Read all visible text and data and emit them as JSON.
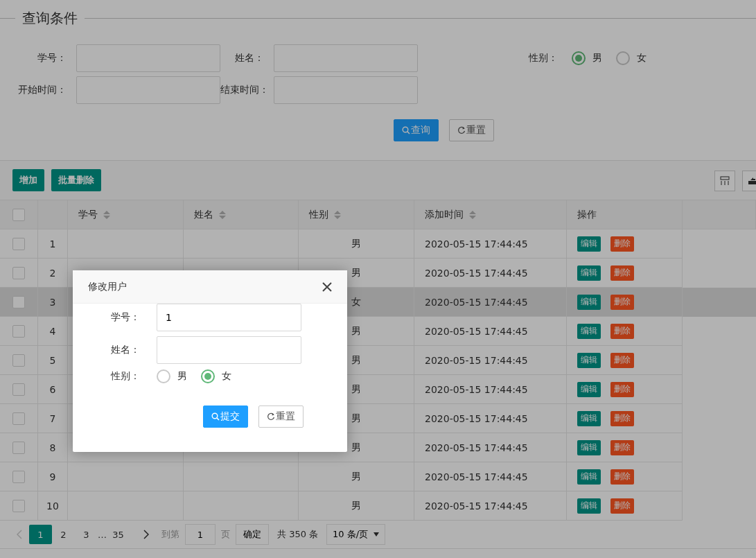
{
  "query": {
    "legend": "查询条件",
    "fields": [
      {
        "label": "学号："
      },
      {
        "label": "姓名："
      },
      {
        "label": "开始时间："
      },
      {
        "label": "结束时间："
      }
    ],
    "gender": {
      "label": "性别：",
      "options": [
        {
          "label": "男",
          "selected": true
        },
        {
          "label": "女",
          "selected": false
        }
      ]
    },
    "buttons": [
      {
        "kind": "primary",
        "label": "查询"
      },
      {
        "kind": "reset",
        "label": "重置"
      }
    ]
  },
  "toolbar": {
    "buttons": [
      "增加",
      "批量删除"
    ]
  },
  "table": {
    "all_checked": false,
    "columns": [
      {
        "label": "学号",
        "sortable": true
      },
      {
        "label": "姓名",
        "sortable": true
      },
      {
        "label": "性别",
        "sortable": true
      },
      {
        "label": "添加时间",
        "sortable": true
      },
      {
        "label": "操作",
        "sortable": false
      }
    ],
    "rows": [
      {
        "index": "1",
        "gender": "男",
        "time": "2020-05-15 17:44:45",
        "highlighted": false,
        "actions": [
          "编辑",
          "删除"
        ]
      },
      {
        "index": "2",
        "gender": "男",
        "time": "2020-05-15 17:44:45",
        "highlighted": false,
        "actions": [
          "编辑",
          "删除"
        ]
      },
      {
        "index": "3",
        "gender": "女",
        "time": "2020-05-15 17:44:45",
        "highlighted": true,
        "actions": [
          "编辑",
          "删除"
        ]
      },
      {
        "index": "4",
        "gender": "男",
        "time": "2020-05-15 17:44:45",
        "highlighted": false,
        "actions": [
          "编辑",
          "删除"
        ]
      },
      {
        "index": "5",
        "gender": "男",
        "time": "2020-05-15 17:44:45",
        "highlighted": false,
        "actions": [
          "编辑",
          "删除"
        ]
      },
      {
        "index": "6",
        "gender": "男",
        "time": "2020-05-15 17:44:45",
        "highlighted": false,
        "actions": [
          "编辑",
          "删除"
        ]
      },
      {
        "index": "7",
        "gender": "男",
        "time": "2020-05-15 17:44:45",
        "highlighted": false,
        "actions": [
          "编辑",
          "删除"
        ]
      },
      {
        "index": "8",
        "gender": "男",
        "time": "2020-05-15 17:44:45",
        "highlighted": false,
        "actions": [
          "编辑",
          "删除"
        ]
      },
      {
        "index": "9",
        "gender": "男",
        "time": "2020-05-15 17:44:45",
        "highlighted": false,
        "actions": [
          "编辑",
          "删除"
        ]
      },
      {
        "index": "10",
        "gender": "男",
        "time": "2020-05-15 17:44:45",
        "highlighted": false,
        "actions": [
          "编辑",
          "删除"
        ]
      }
    ]
  },
  "pagination": {
    "pages": [
      {
        "label": "1",
        "selected": true
      },
      {
        "label": "2",
        "selected": false
      },
      {
        "label": "3",
        "selected": false
      }
    ],
    "ellipsis": "…",
    "last": "35",
    "goto": "到第",
    "page_value": "1",
    "page_unit": "页",
    "confirm": "确定",
    "total": "共 350 条",
    "page_size": "10 条/页"
  },
  "dialog": {
    "title": "修改用户",
    "fields": [
      {
        "label": "学号：",
        "value": "1"
      },
      {
        "label": "姓名："
      }
    ],
    "gender": {
      "label": "性别：",
      "options": [
        {
          "label": "男",
          "selected": false
        },
        {
          "label": "女",
          "selected": true
        }
      ]
    },
    "buttons": [
      {
        "kind": "primary",
        "label": "提交"
      },
      {
        "kind": "reset",
        "label": "重置"
      }
    ]
  }
}
